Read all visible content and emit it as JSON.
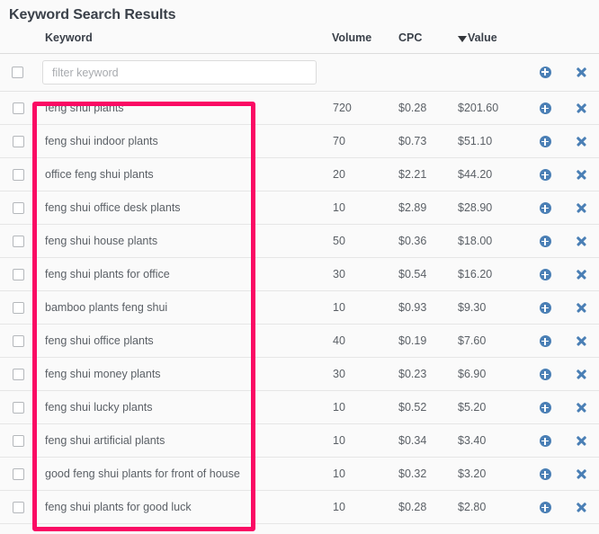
{
  "panel": {
    "title": "Keyword Search Results"
  },
  "table": {
    "columns": {
      "keyword": "Keyword",
      "volume": "Volume",
      "cpc": "CPC",
      "value": "Value",
      "sort_indicator": "descending-caret"
    },
    "filter": {
      "placeholder": "filter keyword",
      "value": ""
    },
    "icons": {
      "add": "add-circle-icon",
      "remove": "close-x-icon",
      "checkbox": "checkbox-icon"
    },
    "rows": [
      {
        "keyword": "feng shui plants",
        "volume": "720",
        "cpc": "$0.28",
        "value": "$201.60"
      },
      {
        "keyword": "feng shui indoor plants",
        "volume": "70",
        "cpc": "$0.73",
        "value": "$51.10"
      },
      {
        "keyword": "office feng shui plants",
        "volume": "20",
        "cpc": "$2.21",
        "value": "$44.20"
      },
      {
        "keyword": "feng shui office desk plants",
        "volume": "10",
        "cpc": "$2.89",
        "value": "$28.90"
      },
      {
        "keyword": "feng shui house plants",
        "volume": "50",
        "cpc": "$0.36",
        "value": "$18.00"
      },
      {
        "keyword": "feng shui plants for office",
        "volume": "30",
        "cpc": "$0.54",
        "value": "$16.20"
      },
      {
        "keyword": "bamboo plants feng shui",
        "volume": "10",
        "cpc": "$0.93",
        "value": "$9.30"
      },
      {
        "keyword": "feng shui office plants",
        "volume": "40",
        "cpc": "$0.19",
        "value": "$7.60"
      },
      {
        "keyword": "feng shui money plants",
        "volume": "30",
        "cpc": "$0.23",
        "value": "$6.90"
      },
      {
        "keyword": "feng shui lucky plants",
        "volume": "10",
        "cpc": "$0.52",
        "value": "$5.20"
      },
      {
        "keyword": "feng shui artificial plants",
        "volume": "10",
        "cpc": "$0.34",
        "value": "$3.40"
      },
      {
        "keyword": "good feng shui plants for front of house",
        "volume": "10",
        "cpc": "$0.32",
        "value": "$3.20"
      },
      {
        "keyword": "feng shui plants for good luck",
        "volume": "10",
        "cpc": "$0.28",
        "value": "$2.80"
      }
    ]
  },
  "annotation": {
    "highlight_color": "#fa0a64",
    "target": "keyword-column"
  }
}
